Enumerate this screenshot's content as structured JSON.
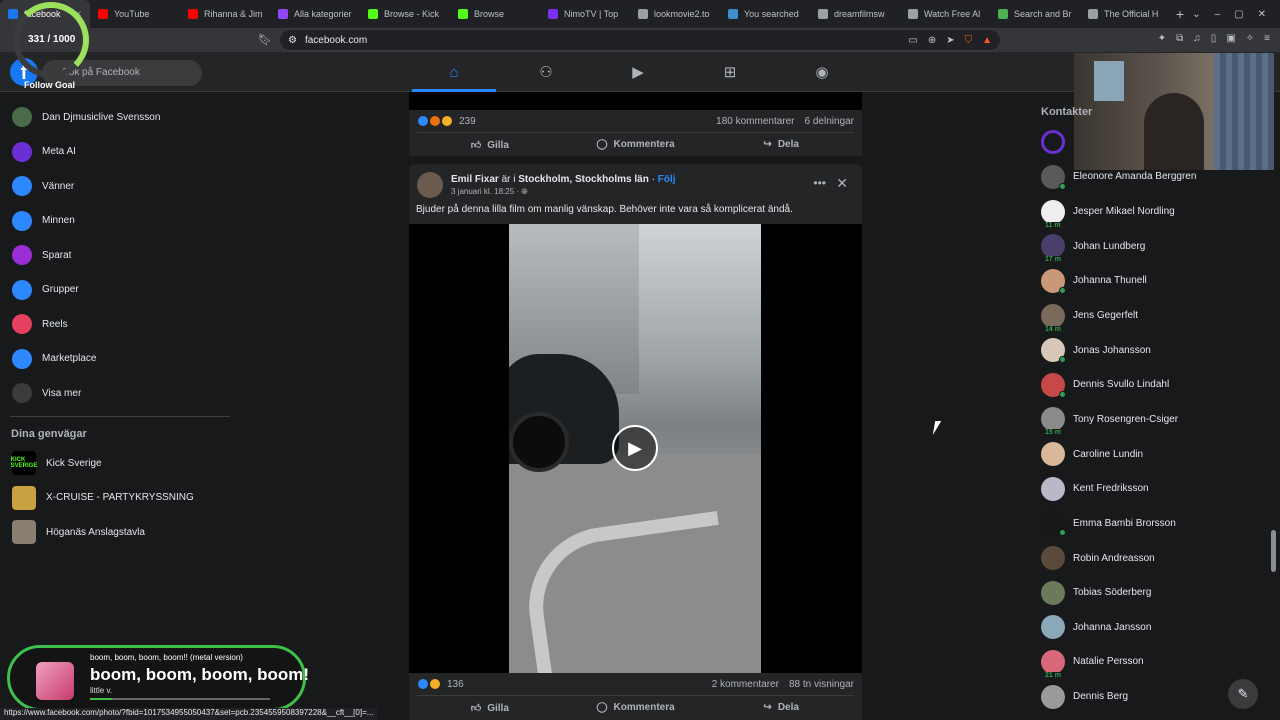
{
  "browser": {
    "tabs": [
      {
        "label": "facebook",
        "color": "#1877f2",
        "active": true
      },
      {
        "label": "YouTube",
        "color": "#ff0000"
      },
      {
        "label": "Rihanna & Jim",
        "color": "#ff0000"
      },
      {
        "label": "Alla kategorier",
        "color": "#9146ff"
      },
      {
        "label": "Browse - Kick",
        "color": "#53fc18"
      },
      {
        "label": "Browse",
        "color": "#53fc18"
      },
      {
        "label": "NimoTV | Top",
        "color": "#7b2ff7"
      },
      {
        "label": "lookmovie2.to",
        "color": "#9aa0a6"
      },
      {
        "label": "You searched",
        "color": "#3f8fcc"
      },
      {
        "label": "dreamfilmsw",
        "color": "#9aa0a6"
      },
      {
        "label": "Watch Free Al",
        "color": "#9aa0a6"
      },
      {
        "label": "Search and Br",
        "color": "#4caf50"
      },
      {
        "label": "The Official H",
        "color": "#9aa0a6"
      }
    ],
    "url": "facebook.com",
    "status_url": "https://www.facebook.com/photo/?fbid=1017534955050437&set=pcb.2354559508397228&__cft__[0]=..."
  },
  "overlay": {
    "goal_text": "331 / 1000",
    "goal_label": "Follow Goal",
    "song_small": "boom, boom, boom, boom!! (metal version)",
    "song_big": "boom, boom, boom, boom!",
    "artist": "little v.",
    "progress": 0.12
  },
  "header": {
    "search_placeholder": "Sök på Facebook"
  },
  "sidebar": {
    "items": [
      {
        "label": "Dan Djmusiclive Svensson",
        "color": "#4a6b4a"
      },
      {
        "label": "Meta AI",
        "color": "#6b2fd6"
      },
      {
        "label": "Vänner",
        "color": "#2d88ff"
      },
      {
        "label": "Minnen",
        "color": "#2d88ff"
      },
      {
        "label": "Sparat",
        "color": "#9b2fd6"
      },
      {
        "label": "Grupper",
        "color": "#2d88ff"
      },
      {
        "label": "Reels",
        "color": "#e4405f"
      },
      {
        "label": "Marketplace",
        "color": "#2d88ff"
      },
      {
        "label": "Visa mer",
        "color": "#3a3b3c"
      }
    ],
    "shortcuts_title": "Dina genvägar",
    "shortcuts": [
      {
        "label": "Kick Sverige",
        "color": "#000000",
        "badge": "KICK SVERIGE"
      },
      {
        "label": "X-CRUISE - PARTYKRYSSNING",
        "color": "#c8a040",
        "badge": ""
      },
      {
        "label": "Höganäs Anslagstavla",
        "color": "#8a7f72",
        "badge": ""
      }
    ]
  },
  "post1": {
    "reactions": "239",
    "comments": "180 kommentarer",
    "shares": "6 delningar",
    "like": "Gilla",
    "comment": "Kommentera",
    "share": "Dela"
  },
  "post2": {
    "author": "Emil Fixar",
    "verb": " är i ",
    "place": "Stockholm, Stockholms län",
    "follow": "Följ",
    "date": "3 januari kl. 18:25",
    "text": "Bjuder på denna lilla film om manlig vänskap. Behöver inte vara så komplicerat ändå.",
    "reactions": "136",
    "comments": "2 kommentarer",
    "views": "88 tn visningar",
    "like": "Gilla",
    "comment": "Kommentera",
    "share": "Dela"
  },
  "contacts": {
    "title": "Kontakter",
    "items": [
      {
        "name": "",
        "color": "#6b2fd6",
        "online": false,
        "mins": ""
      },
      {
        "name": "Eleonore Amanda Berggren",
        "color": "#5a5a5a",
        "online": true,
        "mins": ""
      },
      {
        "name": "Jesper Mikael Nordling",
        "color": "#eeeeee",
        "online": false,
        "mins": "11 m"
      },
      {
        "name": "Johan Lundberg",
        "color": "#4a3f6b",
        "online": false,
        "mins": "17 m"
      },
      {
        "name": "Johanna Thunell",
        "color": "#c89878",
        "online": true,
        "mins": ""
      },
      {
        "name": "Jens Gegerfelt",
        "color": "#7a6a5a",
        "online": false,
        "mins": "14 m"
      },
      {
        "name": "Jonas Johansson",
        "color": "#d8c8b8",
        "online": true,
        "mins": ""
      },
      {
        "name": "Dennis Svullo Lindahl",
        "color": "#c84848",
        "online": true,
        "mins": ""
      },
      {
        "name": "Tony Rosengren-Csiger",
        "color": "#8a8a8a",
        "online": false,
        "mins": "15 m"
      },
      {
        "name": "Caroline Lundin",
        "color": "#d8b898",
        "online": false,
        "mins": ""
      },
      {
        "name": "Kent Fredriksson",
        "color": "#b8b8c8",
        "online": false,
        "mins": ""
      },
      {
        "name": "Emma Bambi Brorsson",
        "color": "#181818",
        "online": true,
        "mins": ""
      },
      {
        "name": "Robin Andreasson",
        "color": "#5a4a3a",
        "online": false,
        "mins": ""
      },
      {
        "name": "Tobias Söderberg",
        "color": "#6a7a5a",
        "online": false,
        "mins": ""
      },
      {
        "name": "Johanna Jansson",
        "color": "#8aa8b8",
        "online": false,
        "mins": ""
      },
      {
        "name": "Natalie Persson",
        "color": "#d86878",
        "online": false,
        "mins": "21 m"
      },
      {
        "name": "Dennis Berg",
        "color": "#9a9a9a",
        "online": false,
        "mins": ""
      }
    ]
  }
}
